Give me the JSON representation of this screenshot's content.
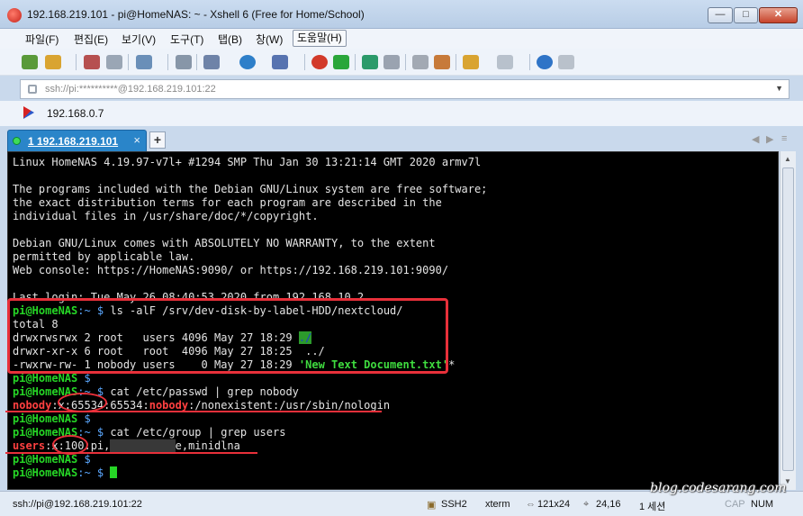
{
  "window": {
    "title": "192.168.219.101 - pi@HomeNAS: ~ - Xshell 6 (Free for Home/School)"
  },
  "menu": {
    "items": [
      {
        "label": "파일(F)"
      },
      {
        "label": "편집(E)"
      },
      {
        "label": "보기(V)"
      },
      {
        "label": "도구(T)"
      },
      {
        "label": "탭(B)"
      },
      {
        "label": "창(W)"
      },
      {
        "label": "도움말(H)"
      }
    ]
  },
  "address": {
    "text": "ssh://pi:**********@192.168.219.101:22"
  },
  "links": {
    "item": "192.168.0.7"
  },
  "tabs": {
    "active_label": "1 192.168.219.101",
    "close": "×",
    "add": "+"
  },
  "terminal": {
    "lines": [
      "Linux HomeNAS 4.19.97-v7l+ #1294 SMP Thu Jan 30 13:21:14 GMT 2020 armv7l",
      "",
      "The programs included with the Debian GNU/Linux system are free software;",
      "the exact distribution terms for each program are described in the",
      "individual files in /usr/share/doc/*/copyright.",
      "",
      "Debian GNU/Linux comes with ABSOLUTELY NO WARRANTY, to the extent",
      "permitted by applicable law.",
      "Web console: https://HomeNAS:9090/ or https://192.168.219.101:9090/",
      "",
      "Last login: Tue May 26 08:40:53 2020 from 192.168.10.2"
    ],
    "prompt_user": "pi@HomeNAS",
    "prompt_path": ":~ $",
    "cmd1": " ls -alF /srv/dev-disk-by-label-HDD/nextcloud/",
    "total": "total 8",
    "ls1a": "drwxrwsrwx 2 root   users 4096 May 27 18:29 ",
    "ls1b": "./",
    "ls2": "drwxr-xr-x 6 root   root  4096 May 27 18:25  ../",
    "ls3a": "-rwxrw-rw- 1 nobody users    0 May 27 18:29 ",
    "ls3b": "'New Text Document.txt'",
    "ls3c": "*",
    "empty_prompt": " $",
    "cmd2": " cat /etc/passwd | grep nobody",
    "passwd_user": "nobody",
    "passwd_mid": ":x:65534:65534:",
    "passwd_name": "nobody",
    "passwd_end": ":/nonexistent:/usr/sbin/nologin",
    "cmd3": " cat /etc/group | grep users",
    "group_name": "users",
    "group_mid": ":x:100:pi,",
    "group_end": "e,minidlna"
  },
  "status": {
    "connection": "ssh://pi@192.168.219.101:22",
    "protocol": "SSH2",
    "term": "xterm",
    "size": "121x24",
    "cursor": "24,16",
    "sessions": "1 세션",
    "cap": "CAP",
    "num": "NUM"
  },
  "watermark": "blog.codesarang.com",
  "colors": {
    "prompt": "#26d626",
    "path": "#5ba8ff",
    "highlight_red": "#e8303a",
    "tab_active": "#2a85c9"
  }
}
